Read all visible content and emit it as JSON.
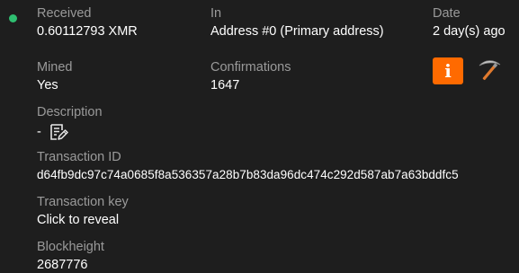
{
  "status": {
    "color": "#2fbf71"
  },
  "received": {
    "label": "Received",
    "value": "0.60112793 XMR"
  },
  "address": {
    "label": "In",
    "value": "Address #0 (Primary address)"
  },
  "date": {
    "label": "Date",
    "value": "2 day(s) ago"
  },
  "mined": {
    "label": "Mined",
    "value": "Yes"
  },
  "confirmations": {
    "label": "Confirmations",
    "value": "1647"
  },
  "description": {
    "label": "Description",
    "value": "-",
    "edit_icon": "edit-note-icon"
  },
  "transaction_id": {
    "label": "Transaction ID",
    "value": "d64fb9dc97c74a0685f8a536357a28b7b83da96dc474c292d587ab7a63bddfc5"
  },
  "transaction_key": {
    "label": "Transaction key",
    "value": "Click to reveal"
  },
  "blockheight": {
    "label": "Blockheight",
    "value": "2687776"
  },
  "actions": {
    "info_icon": "info-icon",
    "info_glyph": "i",
    "info_color": "#ff6a00",
    "mined_icon": "pickaxe-icon"
  }
}
